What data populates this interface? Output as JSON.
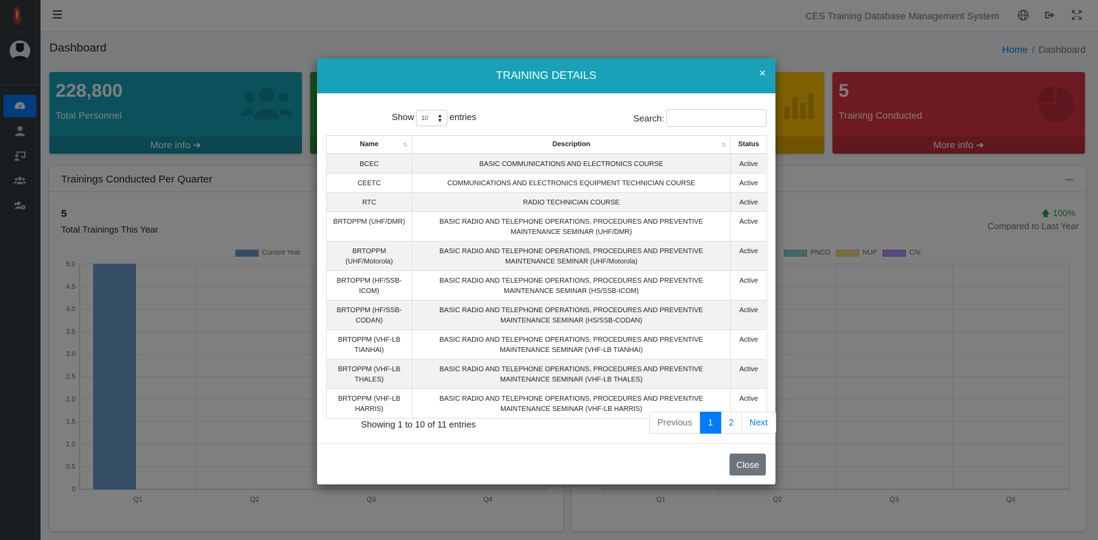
{
  "app": {
    "system_name": "CES Training Database Management System",
    "page_title": "Dashboard",
    "breadcrumb": {
      "home": "Home",
      "current": "Dashboard"
    }
  },
  "sidebar": {
    "items": [
      {
        "icon": "dashboard-icon",
        "active": true
      },
      {
        "icon": "user-icon",
        "active": false
      },
      {
        "icon": "training-icon",
        "active": false
      },
      {
        "icon": "users-icon",
        "active": false
      },
      {
        "icon": "users-cog-icon",
        "active": false
      }
    ]
  },
  "navbar": {
    "icons": [
      "globe-icon",
      "sign-out-icon",
      "expand-icon"
    ]
  },
  "stat_boxes": [
    {
      "value": "228,800",
      "label": "Total Personnel",
      "footer": "More info",
      "color": "#17a2b8"
    },
    {
      "value": "",
      "label": "",
      "footer": "",
      "color": "#28a745"
    },
    {
      "value": "",
      "label": "",
      "footer": "",
      "color": "#ffc107"
    },
    {
      "value": "5",
      "label": "Training Conducted",
      "footer": "More info",
      "color": "#dc3545"
    }
  ],
  "cards": {
    "left": {
      "title": "Trainings Conducted Per Quarter",
      "total_value": "5",
      "total_label": "Total Trainings This Year"
    },
    "right": {
      "percent": "100%",
      "compare_label": "Compared to Last Year"
    }
  },
  "chart_data": [
    {
      "type": "bar",
      "categories": [
        "Q1",
        "Q2",
        "Q3",
        "Q4"
      ],
      "series": [
        {
          "name": "Current Year",
          "values": [
            5,
            0,
            0,
            0
          ],
          "color": "#4e8fc6"
        }
      ],
      "ylim": [
        0,
        5.0
      ],
      "yticks": [
        "0",
        "0.5",
        "1.0",
        "1.5",
        "2.0",
        "2.5",
        "3.0",
        "3.5",
        "4.0",
        "4.5",
        "5.0"
      ],
      "grid": true,
      "legend": "top"
    },
    {
      "type": "bar",
      "categories": [
        "Q1",
        "Q2",
        "Q3",
        "Q4"
      ],
      "series": [
        {
          "name": "PNCO",
          "color": "#5bbfc0"
        },
        {
          "name": "NUP",
          "color": "#f0c05a"
        },
        {
          "name": "CIV",
          "color": "#9966ff"
        }
      ],
      "grid": true,
      "legend": "top"
    }
  ],
  "modal": {
    "title": "TRAINING DETAILS",
    "close_x": "×",
    "show_label": "Show",
    "page_length": "10",
    "entries_label": "entries",
    "search_label": "Search:",
    "columns": [
      "Name",
      "Description",
      "Status"
    ],
    "rows": [
      {
        "name": "BCEC",
        "description": "BASIC COMMUNICATIONS AND ELECTRONICS COURSE",
        "status": "Active"
      },
      {
        "name": "CEETC",
        "description": "COMMUNICATIONS AND ELECTRONICS EQUIPMENT TECHNICIAN COURSE",
        "status": "Active"
      },
      {
        "name": "RTC",
        "description": "RADIO TECHNICIAN COURSE",
        "status": "Active"
      },
      {
        "name": "BRTOPPM (UHF/DMR)",
        "description": "BASIC RADIO AND TELEPHONE OPERATIONS, PROCEDURES AND PREVENTIVE MAINTENANCE SEMINAR (UHF/DMR)",
        "status": "Active"
      },
      {
        "name": "BRTOPPM (UHF/Motorola)",
        "description": "BASIC RADIO AND TELEPHONE OPERATIONS, PROCEDURES AND PREVENTIVE MAINTENANCE SEMINAR (UHF/Motorola)",
        "status": "Active"
      },
      {
        "name": "BRTOPPM (HF/SSB-ICOM)",
        "description": "BASIC RADIO AND TELEPHONE OPERATIONS, PROCEDURES AND PREVENTIVE MAINTENANCE SEMINAR (HS/SSB-ICOM)",
        "status": "Active"
      },
      {
        "name": "BRTOPPM (HF/SSB-CODAN)",
        "description": "BASIC RADIO AND TELEPHONE OPERATIONS, PROCEDURES AND PREVENTIVE MAINTENANCE SEMINAR (HS/SSB-CODAN)",
        "status": "Active"
      },
      {
        "name": "BRTOPPM (VHF-LB TIANHAI)",
        "description": "BASIC RADIO AND TELEPHONE OPERATIONS, PROCEDURES AND PREVENTIVE MAINTENANCE SEMINAR (VHF-LB TIANHAI)",
        "status": "Active"
      },
      {
        "name": "BRTOPPM (VHF-LB THALES)",
        "description": "BASIC RADIO AND TELEPHONE OPERATIONS, PROCEDURES AND PREVENTIVE MAINTENANCE SEMINAR (VHF-LB THALES)",
        "status": "Active"
      },
      {
        "name": "BRTOPPM (VHF-LB HARRIS)",
        "description": "BASIC RADIO AND TELEPHONE OPERATIONS, PROCEDURES AND PREVENTIVE MAINTENANCE SEMINAR (VHF-LB HARRIS)",
        "status": "Active"
      }
    ],
    "info": "Showing 1 to 10 of 11 entries",
    "pagination": {
      "previous": "Previous",
      "pages": [
        "1",
        "2"
      ],
      "active_page": "1",
      "next": "Next"
    },
    "close_button": "Close"
  }
}
